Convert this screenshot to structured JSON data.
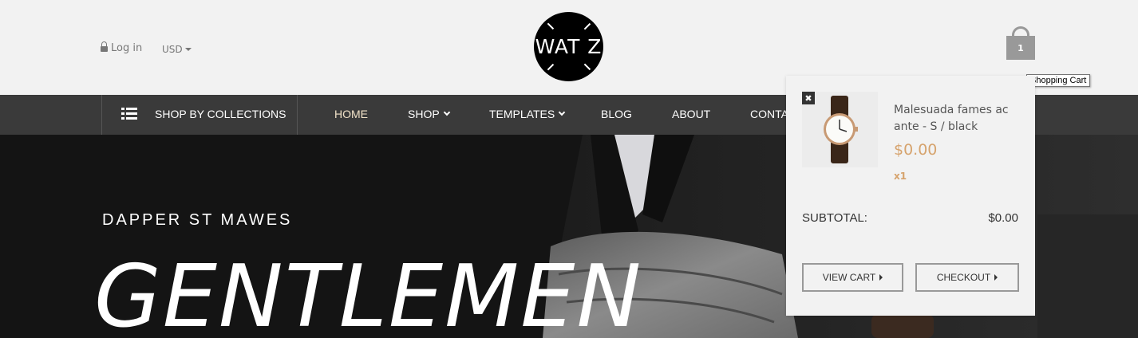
{
  "header": {
    "login_label": "Log in",
    "currency": "USD",
    "logo_text": "WAT Z",
    "cart_count": "1",
    "cart_tooltip": "Shopping Cart"
  },
  "nav": {
    "collections_label": "SHOP BY COLLECTIONS",
    "items": [
      {
        "label": "HOME",
        "active": true
      },
      {
        "label": "SHOP",
        "has_dropdown": true
      },
      {
        "label": "TEMPLATES",
        "has_dropdown": true
      },
      {
        "label": "BLOG"
      },
      {
        "label": "ABOUT"
      },
      {
        "label": "CONTA"
      }
    ]
  },
  "hero": {
    "subtitle": "DAPPER ST MAWES",
    "title": "GENTLEMEN"
  },
  "cart_dropdown": {
    "remove_icon": "close-icon",
    "item": {
      "name": "Malesuada fames ac ante - S / black",
      "price": "$0.00",
      "quantity": "x1"
    },
    "subtotal_label": "SUBTOTAL:",
    "subtotal_value": "$0.00",
    "view_cart_label": "VIEW CART",
    "checkout_label": "CHECKOUT"
  },
  "colors": {
    "accent_gold": "#d6a36d",
    "nav_bg": "#3a3a3a",
    "header_bg": "#f2f2f2",
    "active_nav": "#f1e2c8"
  }
}
